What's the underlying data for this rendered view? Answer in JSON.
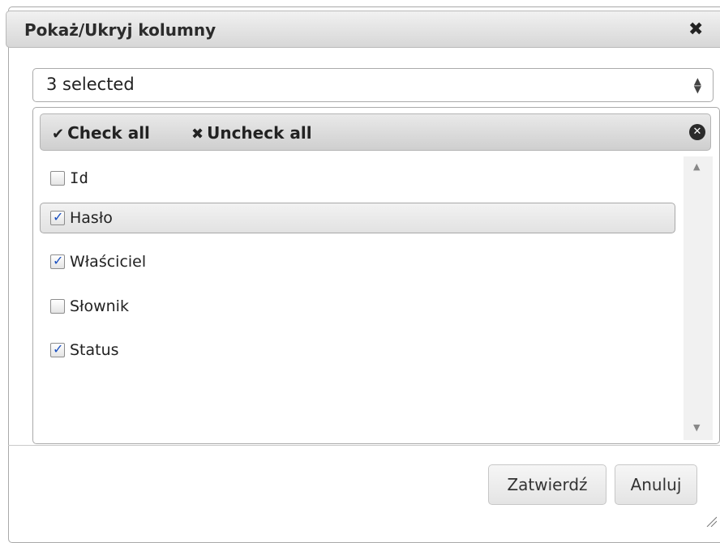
{
  "dialog": {
    "title": "Pokaż/Ukryj kolumny",
    "close_glyph": "✖"
  },
  "multiselect": {
    "selected_text": "3 selected",
    "arrows_glyph": "⬍",
    "header": {
      "check_all_label": "Check all",
      "check_all_icon": "check-icon",
      "uncheck_all_label": "Uncheck all",
      "uncheck_all_icon": "x-icon",
      "close_icon": "circle-close-icon"
    },
    "options": [
      {
        "label": "Id",
        "checked": false
      },
      {
        "label": "Hasło",
        "checked": true
      },
      {
        "label": "Właściciel",
        "checked": true
      },
      {
        "label": "Słownik",
        "checked": false
      },
      {
        "label": "Status",
        "checked": true
      }
    ]
  },
  "footer": {
    "confirm_label": "Zatwierdź",
    "cancel_label": "Anuluj"
  }
}
